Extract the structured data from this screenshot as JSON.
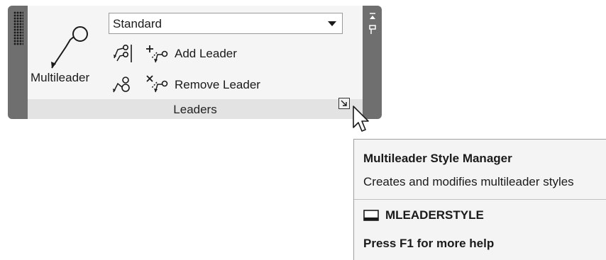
{
  "panel": {
    "title": "Leaders",
    "multileader_button": {
      "label": "Multileader",
      "icon": "multileader-icon"
    },
    "style_dropdown": {
      "value": "Standard"
    },
    "add_leader": {
      "label": "Add Leader",
      "icon": "add-leader-icon"
    },
    "remove_leader": {
      "label": "Remove Leader",
      "icon": "remove-leader-icon"
    },
    "align_icon": "align-leaders-icon",
    "collect_icon": "collect-leaders-icon",
    "launcher_icon": "dialog-launcher-icon"
  },
  "tooltip": {
    "title": "Multileader Style Manager",
    "description": "Creates and modifies multileader styles",
    "command": "MLEADERSTYLE",
    "command_icon": "command-line-icon",
    "help": "Press F1 for more help"
  },
  "colors": {
    "panel_frame": "#6f6f6f",
    "panel_bg": "#f5f5f5",
    "panel_footer": "#e3e3e3",
    "tooltip_bg": "#f4f4f4"
  }
}
